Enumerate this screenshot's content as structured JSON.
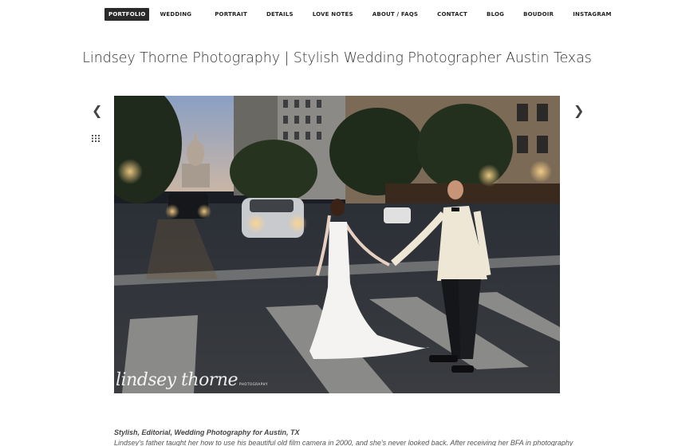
{
  "nav": {
    "items": [
      {
        "label": "PORTFOLIO",
        "active": true
      },
      {
        "label": "WEDDING"
      },
      {
        "label": "PORTRAIT"
      },
      {
        "label": "DETAILS"
      },
      {
        "label": "LOVE NOTES"
      },
      {
        "label": "ABOUT / FAQS"
      },
      {
        "label": "CONTACT"
      },
      {
        "label": "BLOG"
      },
      {
        "label": "BOUDOIR"
      },
      {
        "label": "INSTAGRAM"
      }
    ]
  },
  "header": {
    "title": "Lindsey Thorne Photography | Stylish Wedding Photographer Austin Texas"
  },
  "gallery": {
    "prev_icon": "chevron-left-icon",
    "next_icon": "chevron-right-icon",
    "grid_icon": "grid-icon",
    "prev_glyph": "❮",
    "next_glyph": "❯",
    "watermark": "lindsey thorne",
    "watermark_sub": "PHOTOGRAPHY"
  },
  "content": {
    "caption_title": "Stylish, Editorial, Wedding Photography for Austin, TX",
    "caption_body": "Lindsey's father taught her how to use his beautiful old film camera in 2000, and she's never looked back. After receiving her BFA in photography"
  },
  "colors": {
    "nav_active_bg": "#2a2a2a",
    "text": "#333333"
  }
}
